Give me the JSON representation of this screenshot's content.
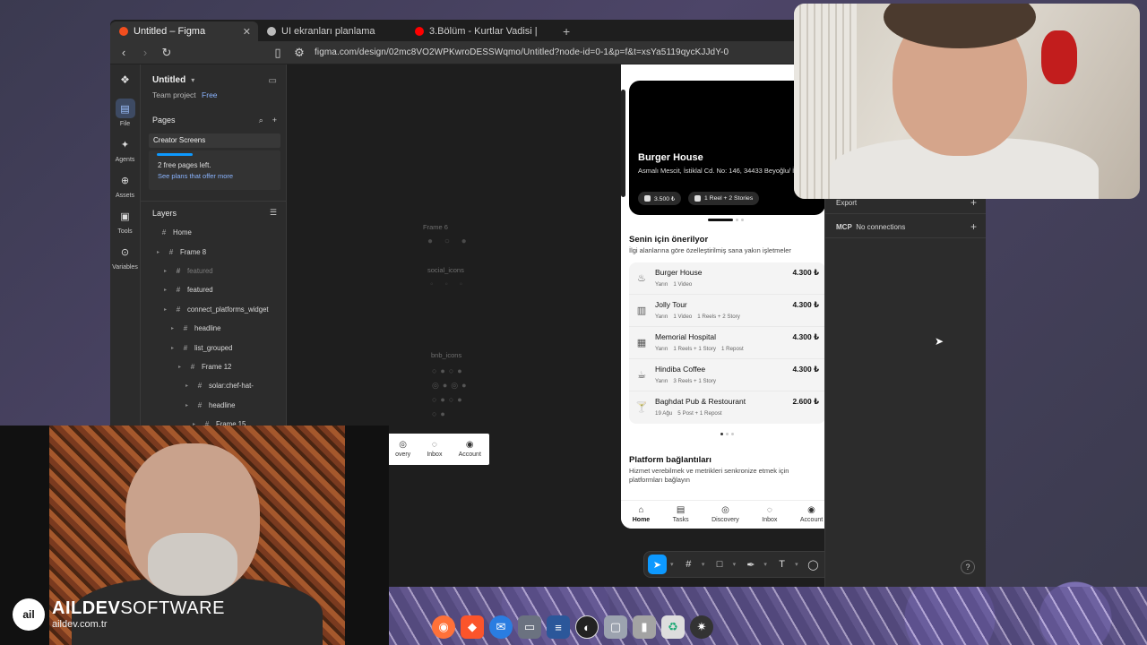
{
  "browser": {
    "tabs": [
      {
        "label": "Untitled – Figma",
        "favicon_color": "#f24e1e",
        "active": true
      },
      {
        "label": "UI ekranları planlama",
        "favicon_color": "#bbbbbb",
        "active": false
      },
      {
        "label": "3.Bölüm - Kurtlar Vadisi |",
        "favicon_color": "#ff0000",
        "active": false
      }
    ],
    "url": "figma.com/design/02mc8VO2WPKwroDESSWqmo/Untitled?node-id=0-1&p=f&t=xsYa5119qycKJJdY-0"
  },
  "rail": {
    "items": [
      {
        "label": "File",
        "icon": "file-icon"
      },
      {
        "label": "Agents",
        "icon": "agents-icon"
      },
      {
        "label": "Assets",
        "icon": "assets-icon"
      },
      {
        "label": "Tools",
        "icon": "tools-icon"
      },
      {
        "label": "Variables",
        "icon": "variables-icon"
      }
    ]
  },
  "left_panel": {
    "file_name": "Untitled",
    "team": "Team project",
    "plan": "Free",
    "pages_heading": "Pages",
    "current_page": "Creator Screens",
    "limit_text": "2 free pages left.",
    "limit_link": "See plans that offer more",
    "layers_heading": "Layers",
    "layers": [
      {
        "name": "Home",
        "depth": 0,
        "dim": false
      },
      {
        "name": "Frame 8",
        "depth": 1,
        "dim": false
      },
      {
        "name": "featured",
        "depth": 2,
        "dim": true
      },
      {
        "name": "featured",
        "depth": 2,
        "dim": false
      },
      {
        "name": "connect_platforms_widget",
        "depth": 2,
        "dim": false
      },
      {
        "name": "headline",
        "depth": 3,
        "dim": false
      },
      {
        "name": "list_grouped",
        "depth": 3,
        "dim": false
      },
      {
        "name": "Frame 12",
        "depth": 4,
        "dim": false
      },
      {
        "name": "solar:chef-hat-",
        "depth": 5,
        "dim": false
      },
      {
        "name": "headline",
        "depth": 5,
        "dim": false
      },
      {
        "name": "Frame 15",
        "depth": 6,
        "dim": false
      }
    ]
  },
  "canvas": {
    "labels": [
      "Frame 6",
      "social_icons",
      "bnb_icons"
    ]
  },
  "phone": {
    "hero": {
      "title": "Burger House",
      "address": "Asmalı Mescit, İstiklal Cd. No: 146, 34433 Beyoğlu/ İstanbul",
      "chip1": "3.500 ₺",
      "chip2": "1 Reel + 2 Stories"
    },
    "recommend_title": "Senin için önerilyor",
    "recommend_sub": "İlgi alanlarına göre özelleştirilmiş sana yakın işletmeler",
    "items": [
      {
        "name": "Burger House",
        "price": "4.300 ₺",
        "icon": "chef-hat-icon",
        "meta": [
          "Yarın",
          "1 Video"
        ]
      },
      {
        "name": "Jolly Tour",
        "price": "4.300 ₺",
        "icon": "building-icon",
        "meta": [
          "Yarın",
          "1 Video",
          "1 Reels + 2 Story"
        ]
      },
      {
        "name": "Memorial Hospital",
        "price": "4.300 ₺",
        "icon": "hospital-icon",
        "meta": [
          "Yarın",
          "1 Reels + 1 Story",
          "1 Repost"
        ]
      },
      {
        "name": "Hindiba Coffee",
        "price": "4.300 ₺",
        "icon": "coffee-icon",
        "meta": [
          "Yarın",
          "3 Reels + 1 Story"
        ]
      },
      {
        "name": "Baghdat Pub & Restourant",
        "price": "2.600 ₺",
        "icon": "cocktail-icon",
        "meta": [
          "19 Ağu",
          "5 Post + 1 Repost"
        ]
      }
    ],
    "platform_title": "Platform bağlantıları",
    "platform_sub": "Hizmet verebilmek ve metrikleri senkronize etmek için platformları bağlayın",
    "tabs": [
      {
        "label": "Home",
        "icon": "home-icon"
      },
      {
        "label": "Tasks",
        "icon": "tasks-icon"
      },
      {
        "label": "Discovery",
        "icon": "compass-icon"
      },
      {
        "label": "Inbox",
        "icon": "chat-icon"
      },
      {
        "label": "Account",
        "icon": "account-icon"
      }
    ],
    "mini_tabs": [
      {
        "label": "overy",
        "icon": "compass-icon"
      },
      {
        "label": "Inbox",
        "icon": "chat-icon"
      },
      {
        "label": "Account",
        "icon": "account-icon"
      }
    ]
  },
  "right_panel": {
    "export_label": "Export",
    "mcp_label": "MCP",
    "mcp_value": "No connections",
    "help": "?"
  },
  "brand": {
    "logo": "ail",
    "name_bold": "AILDEV",
    "name_light": "SOFTWARE",
    "url": "aildev.com.tr"
  },
  "colors": {
    "figma_blue": "#0d99ff",
    "accent_link": "#8ab4ff"
  }
}
